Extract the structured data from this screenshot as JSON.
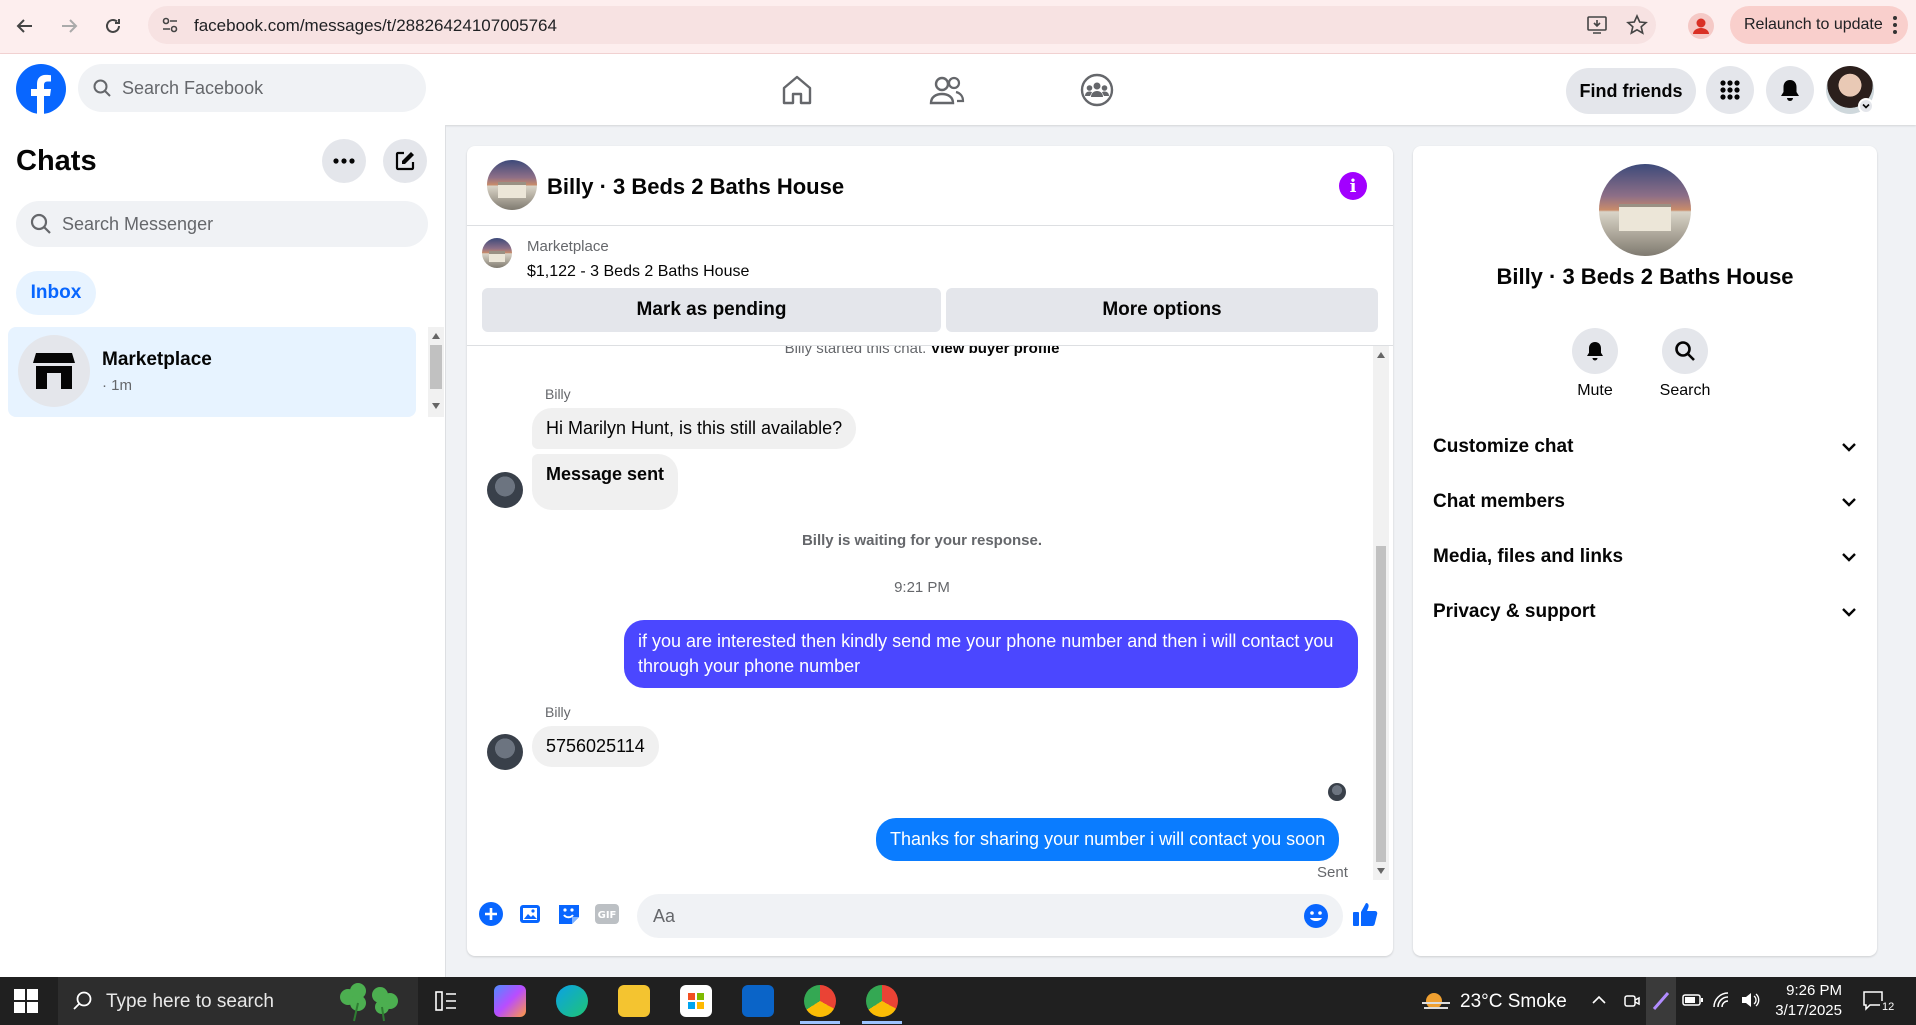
{
  "browser": {
    "url": "facebook.com/messages/t/28826424107005764",
    "relaunch_label": "Relaunch to update"
  },
  "fb_header": {
    "search_placeholder": "Search Facebook",
    "find_friends_label": "Find friends",
    "brand_color": "#0866ff"
  },
  "left": {
    "title": "Chats",
    "search_placeholder": "Search Messenger",
    "inbox_tab": "Inbox",
    "chat_items": [
      {
        "name": "Marketplace",
        "time": "· 1m"
      }
    ]
  },
  "chat": {
    "title": "Billy · 3 Beds 2 Baths House",
    "marketplace_label": "Marketplace",
    "listing": "$1,122 - 3 Beds 2 Baths House",
    "mark_pending_label": "Mark as pending",
    "more_options_label": "More options",
    "started_text": "Billy started this chat.",
    "view_buyer_profile": "View buyer profile",
    "sender_name_1": "Billy",
    "msg_in_1": "Hi Marilyn Hunt, is this still available?",
    "msg_in_2": "Message sent",
    "waiting_text": "Billy is waiting for your response.",
    "timestamp": "9:21 PM",
    "msg_out_1": "if you are interested then kindly send me your phone number and then i will contact you through your phone number",
    "sender_name_2": "Billy",
    "msg_in_3": "5756025114",
    "msg_out_2": "Thanks for sharing your number i will contact you soon",
    "sent_status": "Sent",
    "composer_placeholder": "Aa",
    "outgoing_color_1": "#4b47ff",
    "outgoing_color_2": "#0a7cff"
  },
  "right": {
    "name": "Billy · 3 Beds 2 Baths House",
    "mute_label": "Mute",
    "search_label": "Search",
    "sections": [
      "Customize chat",
      "Chat members",
      "Media, files and links",
      "Privacy & support"
    ]
  },
  "taskbar": {
    "search_placeholder": "Type here to search",
    "weather": "23°C  Smoke",
    "time": "9:26 PM",
    "date": "3/17/2025",
    "notification_count": "12"
  }
}
